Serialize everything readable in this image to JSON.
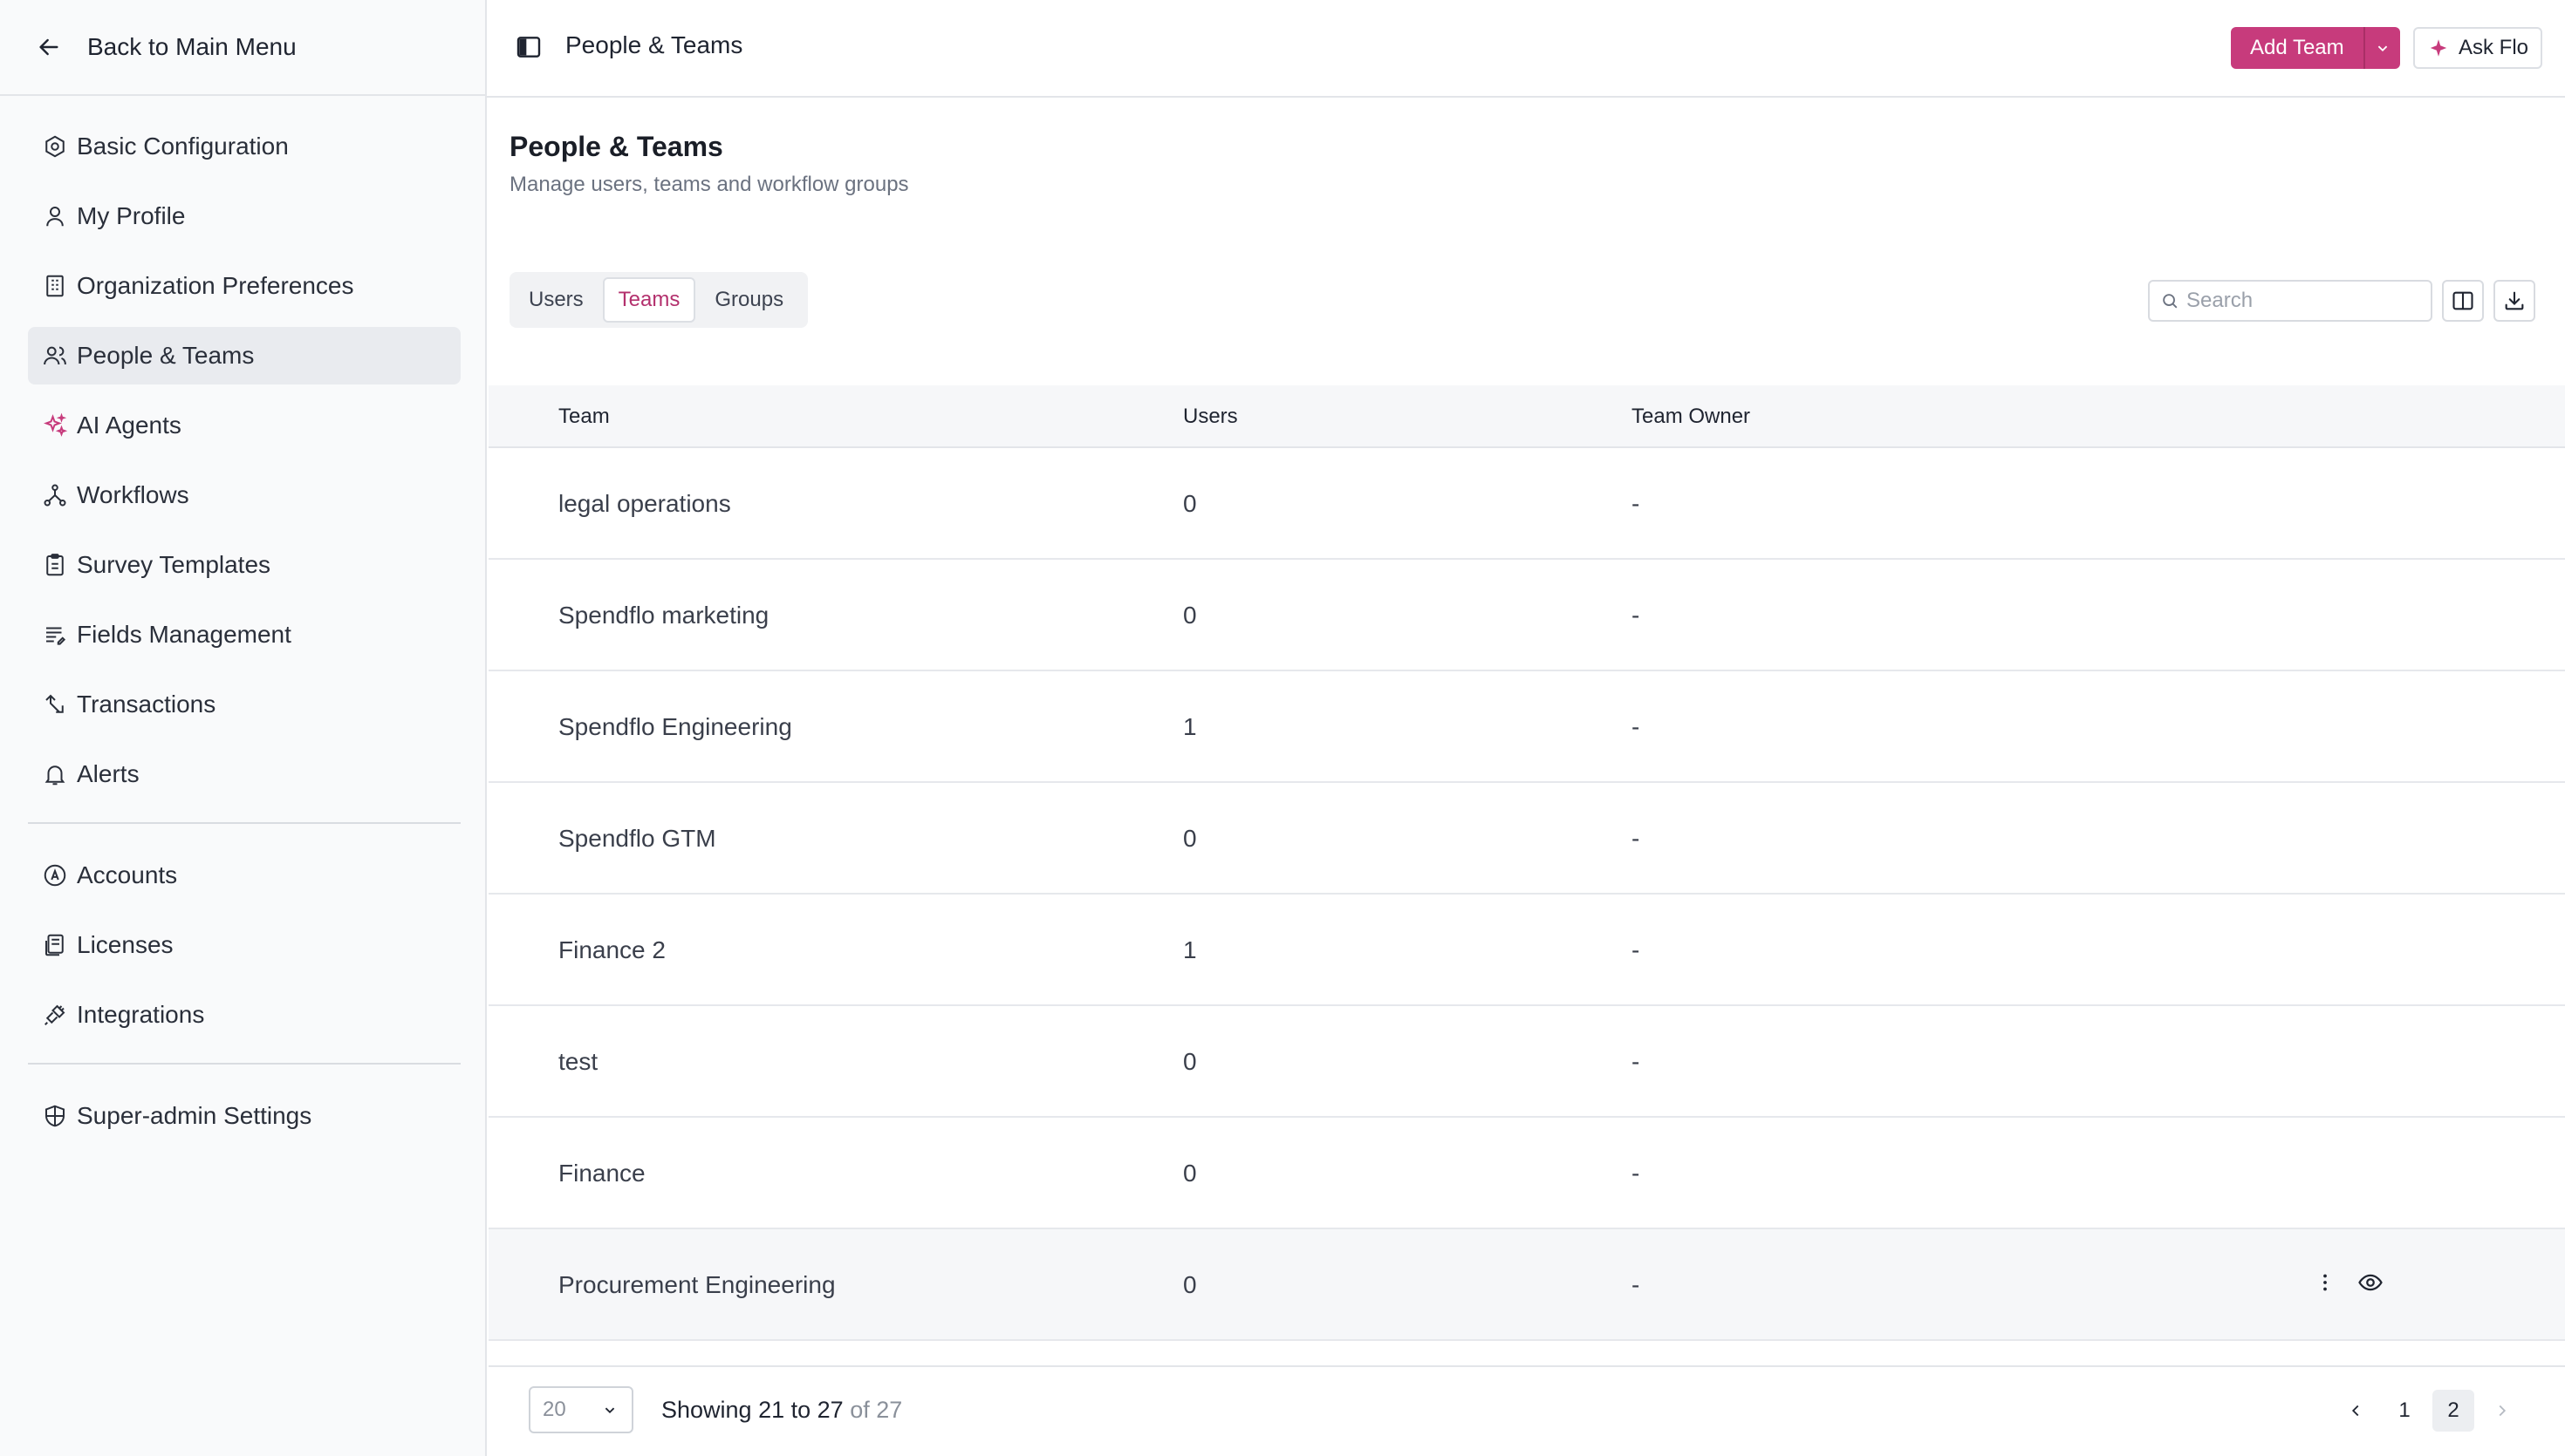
{
  "sidebar": {
    "back_label": "Back to Main Menu",
    "items": [
      {
        "label": "Basic Configuration",
        "icon": "settings-hexagon-icon"
      },
      {
        "label": "My Profile",
        "icon": "user-icon"
      },
      {
        "label": "Organization Preferences",
        "icon": "building-icon"
      },
      {
        "label": "People & Teams",
        "icon": "users-icon",
        "active": true
      },
      {
        "label": "AI Agents",
        "icon": "sparkles-icon"
      },
      {
        "label": "Workflows",
        "icon": "workflow-icon"
      },
      {
        "label": "Survey Templates",
        "icon": "clipboard-icon"
      },
      {
        "label": "Fields Management",
        "icon": "list-edit-icon"
      },
      {
        "label": "Transactions",
        "icon": "transactions-icon"
      },
      {
        "label": "Alerts",
        "icon": "bell-icon"
      }
    ],
    "items_group2": [
      {
        "label": "Accounts",
        "icon": "account-circle-icon"
      },
      {
        "label": "Licenses",
        "icon": "license-icon"
      },
      {
        "label": "Integrations",
        "icon": "plug-icon"
      }
    ],
    "items_group3": [
      {
        "label": "Super-admin Settings",
        "icon": "shield-icon"
      }
    ]
  },
  "header": {
    "title": "People & Teams",
    "add_team_label": "Add Team",
    "ask_flo_label": "Ask Flo"
  },
  "page": {
    "title": "People & Teams",
    "subtitle": "Manage users, teams and workflow groups"
  },
  "tabs": [
    {
      "label": "Users",
      "active": false
    },
    {
      "label": "Teams",
      "active": true
    },
    {
      "label": "Groups",
      "active": false
    }
  ],
  "search": {
    "placeholder": "Search",
    "value": ""
  },
  "table": {
    "columns": [
      "Team",
      "Users",
      "Team Owner"
    ],
    "rows": [
      {
        "team": "legal operations",
        "users": "0",
        "owner": "-"
      },
      {
        "team": "Spendflo marketing",
        "users": "0",
        "owner": "-"
      },
      {
        "team": "Spendflo Engineering",
        "users": "1",
        "owner": "-"
      },
      {
        "team": "Spendflo GTM",
        "users": "0",
        "owner": "-"
      },
      {
        "team": "Finance 2",
        "users": "1",
        "owner": "-"
      },
      {
        "team": "test",
        "users": "0",
        "owner": "-"
      },
      {
        "team": "Finance",
        "users": "0",
        "owner": "-"
      },
      {
        "team": "Procurement Engineering",
        "users": "0",
        "owner": "-",
        "hovered": true
      }
    ]
  },
  "footer": {
    "page_size": "20",
    "showing_prefix": "Showing 21 to 27",
    "showing_total": "of 27",
    "pages": [
      "1",
      "2"
    ],
    "current_page": "2"
  },
  "colors": {
    "accent": "#c73b7c",
    "active_tab_text": "#b3306d"
  }
}
